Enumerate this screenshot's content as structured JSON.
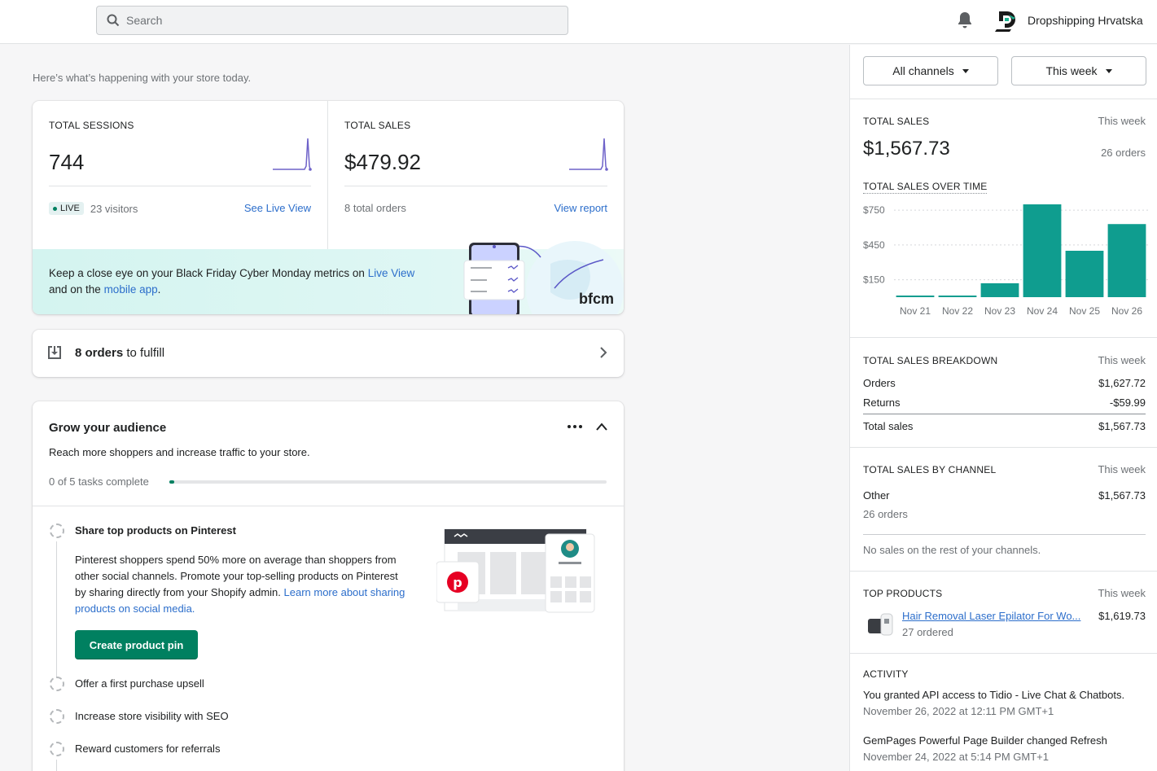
{
  "topbar": {
    "search_placeholder": "Search",
    "store_name": "Dropshipping Hrvatska"
  },
  "intro": "Here’s what’s happening with your store today.",
  "sessions": {
    "label": "TOTAL SESSIONS",
    "value": "744",
    "live_badge": "LIVE",
    "visitors": "23 visitors",
    "link": "See Live View"
  },
  "sales": {
    "label": "TOTAL SALES",
    "value": "$479.92",
    "orders": "8 total orders",
    "link": "View report"
  },
  "bfcm": {
    "text_pre": "Keep a close eye on your Black Friday Cyber Monday metrics on ",
    "link1": "Live View",
    "text_mid": " and on the ",
    "link2": "mobile app",
    "text_post": ".",
    "logo": "bfcm"
  },
  "fulfill": {
    "count": "8 orders",
    "suffix": " to fulfill"
  },
  "grow": {
    "title": "Grow your audience",
    "description": "Reach more shoppers and increase traffic to your store.",
    "progress_label": "0 of 5 tasks complete",
    "progress_fraction": 0.01,
    "tasks": [
      {
        "title": "Share top products on Pinterest",
        "body": "Pinterest shoppers spend 50% more on average than shoppers from other social channels. Promote your top-selling products on Pinterest by sharing directly from your Shopify admin. ",
        "link": "Learn more about sharing products on social media.",
        "button": "Create product pin"
      },
      {
        "title": "Offer a first purchase upsell"
      },
      {
        "title": "Increase store visibility with SEO"
      },
      {
        "title": "Reward customers for referrals"
      }
    ]
  },
  "right": {
    "channel_button": "All channels",
    "period_button": "This week",
    "total_sales": {
      "label": "TOTAL SALES",
      "period": "This week",
      "value": "$1,567.73",
      "orders": "26 orders",
      "over_time_label": "TOTAL SALES OVER TIME"
    },
    "breakdown": {
      "label": "TOTAL SALES BREAKDOWN",
      "period": "This week",
      "rows": [
        {
          "name": "Orders",
          "value": "$1,627.72"
        },
        {
          "name": "Returns",
          "value": "-$59.99"
        },
        {
          "name": "Total sales",
          "value": "$1,567.73"
        }
      ]
    },
    "by_channel": {
      "label": "TOTAL SALES BY CHANNEL",
      "period": "This week",
      "channel": "Other",
      "value": "$1,567.73",
      "orders": "26 orders",
      "note": "No sales on the rest of your channels."
    },
    "top_products": {
      "label": "TOP PRODUCTS",
      "period": "This week",
      "product": "Hair Removal Laser Epilator For Wo...",
      "ordered": "27 ordered",
      "value": "$1,619.73"
    },
    "activity": {
      "label": "ACTIVITY",
      "items": [
        {
          "text": "You granted API access to Tidio - Live Chat & Chatbots.",
          "time": "November 26, 2022 at 12:11 PM GMT+1"
        },
        {
          "text": "GemPages Powerful Page Builder changed Refresh",
          "time": "November 24, 2022 at 5:14 PM GMT+1"
        }
      ]
    }
  },
  "chart_data": {
    "type": "bar",
    "categories": [
      "Nov 21",
      "Nov 22",
      "Nov 23",
      "Nov 24",
      "Nov 25",
      "Nov 26"
    ],
    "values": [
      5,
      5,
      120,
      800,
      400,
      630
    ],
    "ytick_labels": [
      "$750",
      "$450",
      "$150"
    ],
    "yticks": [
      750,
      450,
      150
    ],
    "ylim": [
      0,
      800
    ],
    "color": "#0f9d8f"
  },
  "colors": {
    "accent_green": "#008060",
    "link_blue": "#2c6ecb",
    "bar_teal": "#0f9d8f"
  }
}
